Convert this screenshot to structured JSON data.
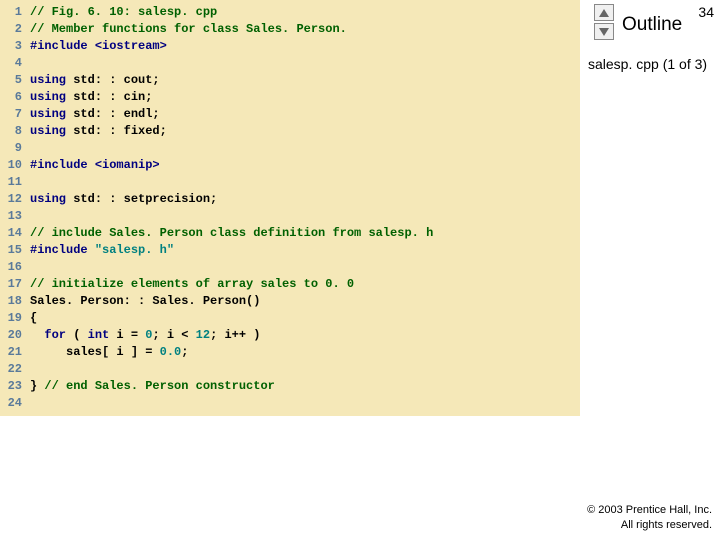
{
  "page_number": "34",
  "outline_label": "Outline",
  "subtitle": "salesp. cpp (1 of 3)",
  "copyright_line1": "© 2003 Prentice Hall, Inc.",
  "copyright_line2": "All rights reserved.",
  "code": [
    {
      "n": "1",
      "tokens": [
        [
          "cmt",
          "// Fig. 6. 10: salesp. cpp"
        ]
      ]
    },
    {
      "n": "2",
      "tokens": [
        [
          "cmt",
          "// Member functions for class Sales. Person."
        ]
      ]
    },
    {
      "n": "3",
      "tokens": [
        [
          "pre",
          "#include "
        ],
        [
          "pre",
          "<iostream>"
        ]
      ]
    },
    {
      "n": "4",
      "tokens": []
    },
    {
      "n": "5",
      "tokens": [
        [
          "kw",
          "using"
        ],
        [
          "pl",
          " std: : cout;"
        ]
      ]
    },
    {
      "n": "6",
      "tokens": [
        [
          "kw",
          "using"
        ],
        [
          "pl",
          " std: : cin;"
        ]
      ]
    },
    {
      "n": "7",
      "tokens": [
        [
          "kw",
          "using"
        ],
        [
          "pl",
          " std: : endl;"
        ]
      ]
    },
    {
      "n": "8",
      "tokens": [
        [
          "kw",
          "using"
        ],
        [
          "pl",
          " std: : fixed;"
        ]
      ]
    },
    {
      "n": "9",
      "tokens": []
    },
    {
      "n": "10",
      "tokens": [
        [
          "pre",
          "#include "
        ],
        [
          "pre",
          "<iomanip>"
        ]
      ]
    },
    {
      "n": "11",
      "tokens": []
    },
    {
      "n": "12",
      "tokens": [
        [
          "kw",
          "using"
        ],
        [
          "pl",
          " std: : setprecision;"
        ]
      ]
    },
    {
      "n": "13",
      "tokens": []
    },
    {
      "n": "14",
      "tokens": [
        [
          "cmt",
          "// include Sales. Person class definition from salesp. h"
        ]
      ]
    },
    {
      "n": "15",
      "tokens": [
        [
          "pre",
          "#include "
        ],
        [
          "str",
          "\"salesp. h\""
        ]
      ]
    },
    {
      "n": "16",
      "tokens": []
    },
    {
      "n": "17",
      "tokens": [
        [
          "cmt",
          "// initialize elements of array sales to 0. 0"
        ]
      ]
    },
    {
      "n": "18",
      "tokens": [
        [
          "pl",
          "Sales. Person: : Sales. Person()"
        ]
      ]
    },
    {
      "n": "19",
      "tokens": [
        [
          "pl",
          "{"
        ]
      ]
    },
    {
      "n": "20",
      "tokens": [
        [
          "pl",
          "  "
        ],
        [
          "kw",
          "for"
        ],
        [
          "pl",
          " ( "
        ],
        [
          "kw",
          "int"
        ],
        [
          "pl",
          " i = "
        ],
        [
          "num",
          "0"
        ],
        [
          "pl",
          "; i < "
        ],
        [
          "num",
          "12"
        ],
        [
          "pl",
          "; i++ )"
        ]
      ]
    },
    {
      "n": "21",
      "tokens": [
        [
          "pl",
          "     sales[ i ] = "
        ],
        [
          "num",
          "0.0"
        ],
        [
          "pl",
          ";"
        ]
      ]
    },
    {
      "n": "22",
      "tokens": []
    },
    {
      "n": "23",
      "tokens": [
        [
          "pl",
          "} "
        ],
        [
          "cmt",
          "// end Sales. Person constructor"
        ]
      ]
    },
    {
      "n": "24",
      "tokens": []
    }
  ]
}
